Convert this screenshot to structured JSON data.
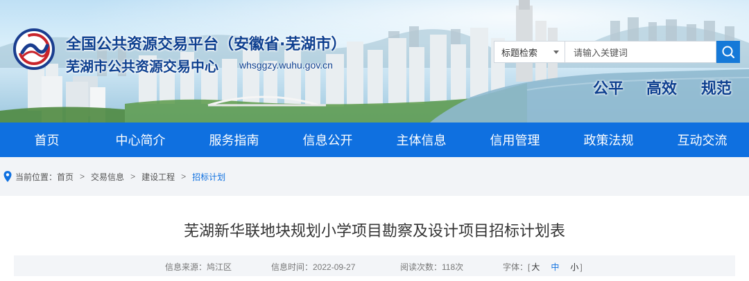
{
  "header": {
    "title_main": "全国公共资源交易平台（安徽省·芜湖市）",
    "title_sub": "芜湖市公共资源交易中心",
    "site_url": "whsggzy.wuhu.gov.cn",
    "slogans": [
      "公平",
      "高效",
      "规范"
    ],
    "search": {
      "select_value": "标题检索",
      "placeholder": "请输入关键词",
      "icon": "search-icon"
    }
  },
  "nav": {
    "items": [
      "首页",
      "中心简介",
      "服务指南",
      "信息公开",
      "主体信息",
      "信用管理",
      "政策法规",
      "互动交流"
    ]
  },
  "breadcrumb": {
    "prefix": "当前位置：",
    "items": [
      "首页",
      "交易信息",
      "建设工程"
    ],
    "separator": ">",
    "current": "招标计划"
  },
  "article": {
    "title": "芜湖新华联地块规划小学项目勘察及设计项目招标计划表",
    "meta": {
      "source": "信息来源：鸠江区",
      "date": "信息时间：2022-09-27",
      "views": "阅读次数：118次",
      "font_label": "字体：[",
      "font_large": "大",
      "font_medium": "中",
      "font_small": "小",
      "font_close": "]"
    }
  },
  "colors": {
    "nav_bg": "#0f70e0",
    "title_blue": "#0d3f8f",
    "search_button": "#1579d8",
    "current_crumb": "#0f70e0"
  }
}
